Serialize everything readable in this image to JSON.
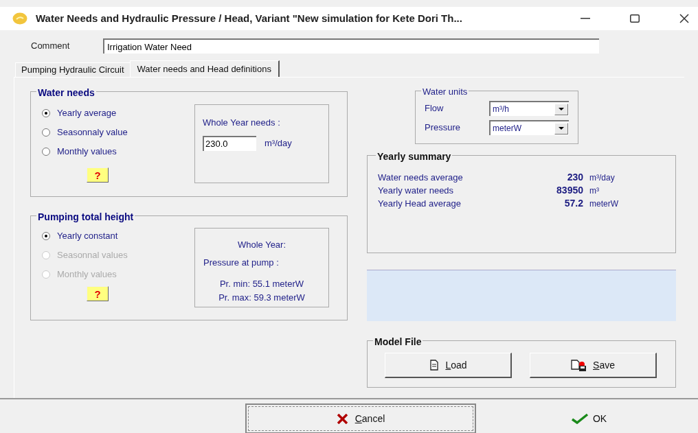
{
  "window": {
    "title": "Water Needs and Hydraulic Pressure / Head, Variant  \"New simulation for Kete Dori Th..."
  },
  "comment": {
    "label": "Comment",
    "value": "Irrigation Water Need"
  },
  "tabs": [
    {
      "label": "Pumping Hydraulic Circuit",
      "selected": false
    },
    {
      "label": "Water needs and Head definitions",
      "selected": true
    }
  ],
  "water_needs": {
    "title": "Water needs",
    "options": [
      {
        "label": "Yearly average",
        "selected": true,
        "disabled": false
      },
      {
        "label": "Seasonnaly value",
        "selected": false,
        "disabled": false
      },
      {
        "label": "Monthly values",
        "selected": false,
        "disabled": false
      }
    ],
    "help": "?",
    "whole_year": {
      "label": "Whole Year needs :",
      "value": "230.0",
      "unit": "m³/day"
    }
  },
  "pumping_total_height": {
    "title": "Pumping total height",
    "options": [
      {
        "label": "Yearly constant",
        "selected": true,
        "disabled": false
      },
      {
        "label": "Seasonnal values",
        "selected": false,
        "disabled": true
      },
      {
        "label": "Monthly values",
        "selected": false,
        "disabled": true
      }
    ],
    "help": "?",
    "whole_year": {
      "title": "Whole Year:",
      "label": "Pressure at pump :",
      "min": "Pr. min: 55.1 meterW",
      "max": "Pr. max: 59.3 meterW"
    }
  },
  "water_units": {
    "title": "Water units",
    "rows": [
      {
        "label": "Flow",
        "value": "m³/h"
      },
      {
        "label": "Pressure",
        "value": "meterW"
      }
    ]
  },
  "yearly_summary": {
    "title": "Yearly summary",
    "rows": [
      {
        "label": "Water needs average",
        "value": "230",
        "unit": "m³/day"
      },
      {
        "label": "Yearly water needs",
        "value": "83950",
        "unit": "m³"
      },
      {
        "label": "Yearly Head average",
        "value": "57.2",
        "unit": "meterW"
      }
    ]
  },
  "model_file": {
    "title": "Model File",
    "buttons": [
      {
        "label": "Load",
        "kind": "load"
      },
      {
        "label": "Save",
        "kind": "save"
      }
    ]
  },
  "buttons": [
    {
      "label": "Cancel",
      "kind": "cancel"
    },
    {
      "label": "OK",
      "kind": "ok"
    }
  ]
}
